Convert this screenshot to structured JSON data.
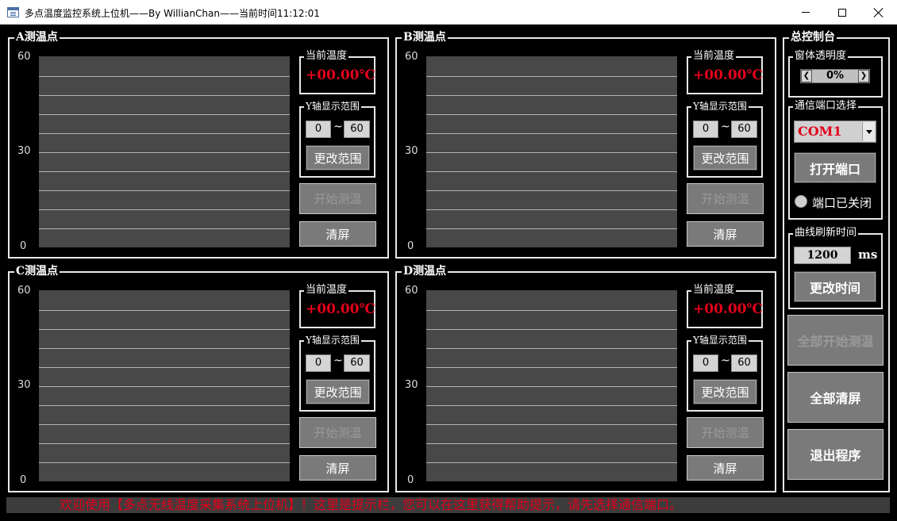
{
  "window": {
    "title": "多点温度监控系统上位机——By WillianChan——当前时间11:12:01",
    "icon": "app-window-icon"
  },
  "panels": [
    {
      "id": "A",
      "title": "A测温点",
      "y_max": "60",
      "y_mid": "30",
      "y_min": "0",
      "temp_label": "当前温度",
      "temp_value": "+00.00℃",
      "range_label": "Y轴显示范围",
      "range_low": "0",
      "range_sep": "~",
      "range_high": "60",
      "change_range": "更改范围",
      "start": "开始测温",
      "clear": "清屏"
    },
    {
      "id": "B",
      "title": "B测温点",
      "y_max": "60",
      "y_mid": "30",
      "y_min": "0",
      "temp_label": "当前温度",
      "temp_value": "+00.00℃",
      "range_label": "Y轴显示范围",
      "range_low": "0",
      "range_sep": "~",
      "range_high": "60",
      "change_range": "更改范围",
      "start": "开始测温",
      "clear": "清屏"
    },
    {
      "id": "C",
      "title": "C测温点",
      "y_max": "60",
      "y_mid": "30",
      "y_min": "0",
      "temp_label": "当前温度",
      "temp_value": "+00.00℃",
      "range_label": "Y轴显示范围",
      "range_low": "0",
      "range_sep": "~",
      "range_high": "60",
      "change_range": "更改范围",
      "start": "开始测温",
      "clear": "清屏"
    },
    {
      "id": "D",
      "title": "D测温点",
      "y_max": "60",
      "y_mid": "30",
      "y_min": "0",
      "temp_label": "当前温度",
      "temp_value": "+00.00℃",
      "range_label": "Y轴显示范围",
      "range_low": "0",
      "range_sep": "~",
      "range_high": "60",
      "change_range": "更改范围",
      "start": "开始测温",
      "clear": "清屏"
    }
  ],
  "control": {
    "title": "总控制台",
    "opacity_label": "窗体透明度",
    "opacity_value": "0%",
    "port_label": "通信端口选择",
    "port_value": "COM1",
    "open_port": "打开端口",
    "port_status": "端口已关闭",
    "refresh_label": "曲线刷新时间",
    "refresh_value": "1200",
    "refresh_unit": "ms",
    "change_time": "更改时间",
    "start_all": "全部开始测温",
    "clear_all": "全部清屏",
    "exit": "退出程序"
  },
  "status_bar": {
    "message": "欢迎使用【多点无线温度采集系统上位机】！这里是提示栏，您可以在这里获得帮助提示，请先选择通信端口。"
  },
  "colors": {
    "background": "#000000",
    "plot": "#484848",
    "temperature": "#e3001b",
    "button": "#7a7a7a"
  }
}
